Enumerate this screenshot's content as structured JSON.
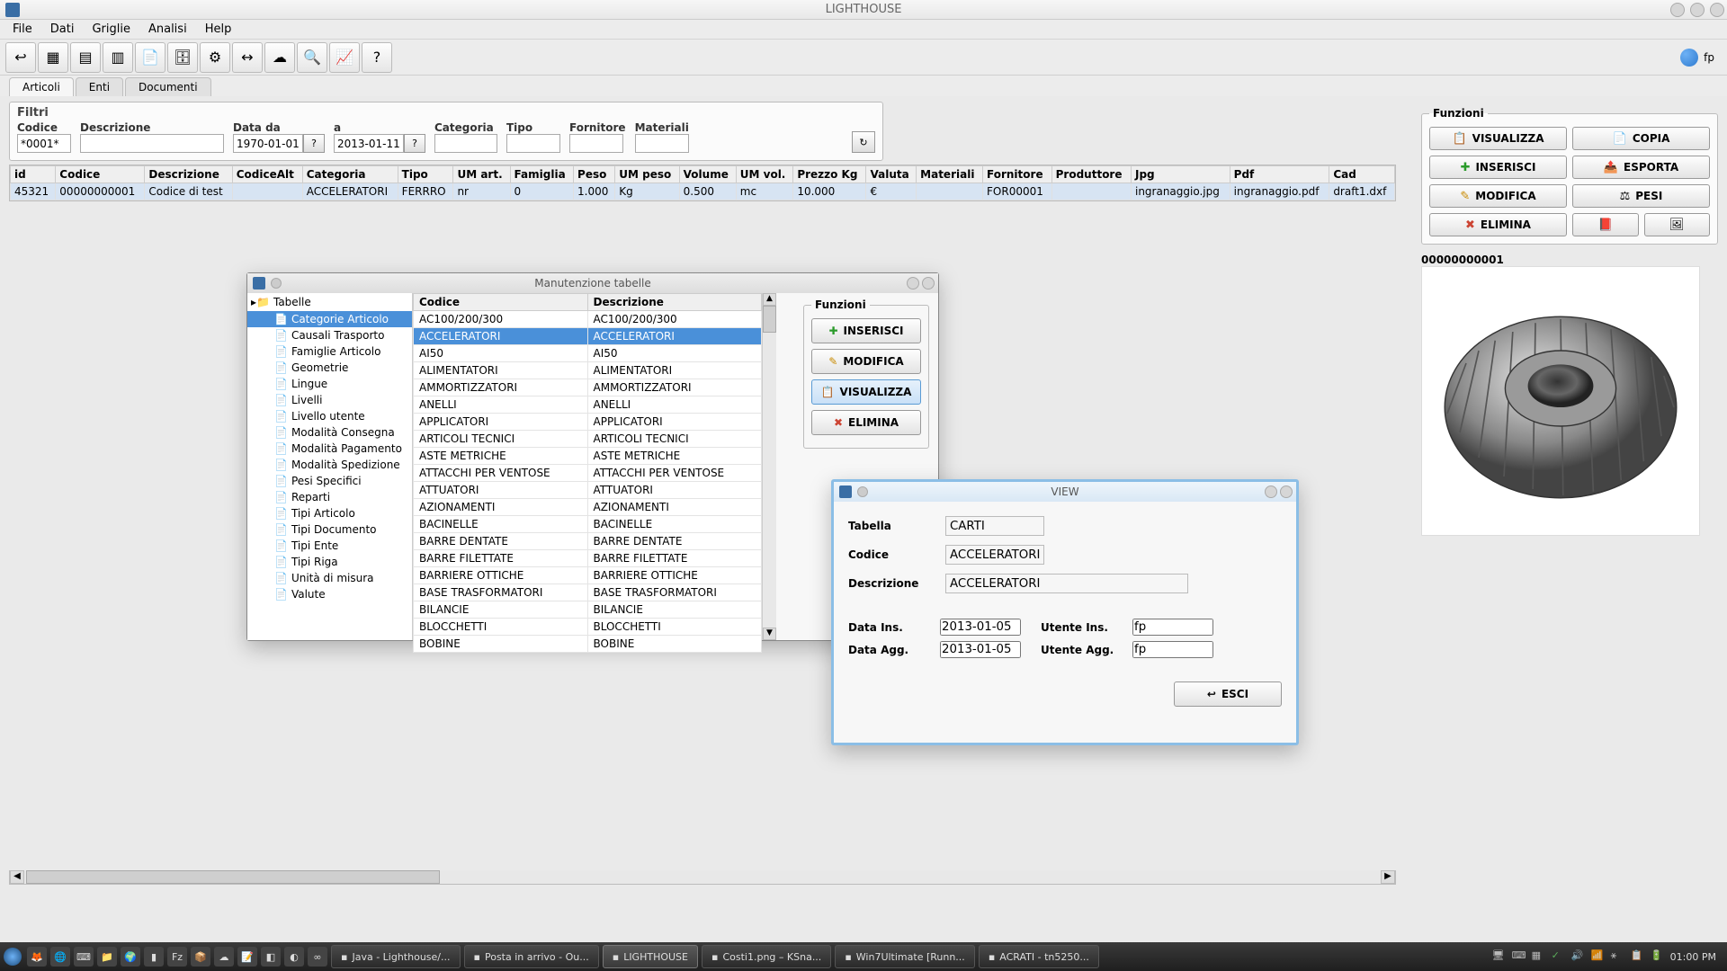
{
  "window_title": "LIGHTHOUSE",
  "menus": [
    "File",
    "Dati",
    "Griglie",
    "Analisi",
    "Help"
  ],
  "user_label": "fp",
  "tabs": [
    {
      "label": "Articoli",
      "active": true
    },
    {
      "label": "Enti",
      "active": false
    },
    {
      "label": "Documenti",
      "active": false
    }
  ],
  "filters": {
    "legend": "Filtri",
    "fields": {
      "codice": {
        "label": "Codice",
        "value": "*0001*"
      },
      "descrizione": {
        "label": "Descrizione",
        "value": ""
      },
      "data_da": {
        "label": "Data da",
        "value": "1970-01-01"
      },
      "data_a": {
        "label": "a",
        "value": "2013-01-11"
      },
      "categoria": {
        "label": "Categoria",
        "value": ""
      },
      "tipo": {
        "label": "Tipo",
        "value": ""
      },
      "fornitore": {
        "label": "Fornitore",
        "value": ""
      },
      "materiali": {
        "label": "Materiali",
        "value": ""
      }
    }
  },
  "table": {
    "columns": [
      "id",
      "Codice",
      "Descrizione",
      "CodiceAlt",
      "Categoria",
      "Tipo",
      "UM art.",
      "Famiglia",
      "Peso",
      "UM peso",
      "Volume",
      "UM vol.",
      "Prezzo Kg",
      "Valuta",
      "Materiali",
      "Fornitore",
      "Produttore",
      "Jpg",
      "Pdf",
      "Cad"
    ],
    "rows": [
      {
        "id": "45321",
        "codice": "00000000001",
        "descr": "Codice di test",
        "codalt": "",
        "cat": "ACCELERATORI",
        "tipo": "FERRRO",
        "um": "nr",
        "fam": "0",
        "peso": "1.000",
        "ump": "Kg",
        "vol": "0.500",
        "umv": "mc",
        "prz": "10.000",
        "val": "€",
        "mat": "",
        "forn": "FOR00001",
        "prod": "",
        "jpg": "ingranaggio.jpg",
        "pdf": "ingranaggio.pdf",
        "cad": "draft1.dxf"
      }
    ]
  },
  "functions": {
    "legend": "Funzioni",
    "buttons": {
      "visualizza": "VISUALIZZA",
      "copia": "COPIA",
      "inserisci": "INSERISCI",
      "esporta": "ESPORTA",
      "modifica": "MODIFICA",
      "pesi": "PESI",
      "elimina": "ELIMINA"
    },
    "code": "00000000001"
  },
  "manut": {
    "title": "Manutenzione tabelle",
    "root": "Tabelle",
    "tree": [
      "Categorie Articolo",
      "Causali Trasporto",
      "Famiglie Articolo",
      "Geometrie",
      "Lingue",
      "Livelli",
      "Livello utente",
      "Modalità Consegna",
      "Modalità Pagamento",
      "Modalità Spedizione",
      "Pesi Specifici",
      "Reparti",
      "Tipi Articolo",
      "Tipi Documento",
      "Tipi Ente",
      "Tipi Riga",
      "Unità di misura",
      "Valute"
    ],
    "tree_selected": 0,
    "list_headers": [
      "Codice",
      "Descrizione"
    ],
    "list": [
      [
        "AC100/200/300",
        "AC100/200/300"
      ],
      [
        "ACCELERATORI",
        "ACCELERATORI"
      ],
      [
        "AI50",
        "AI50"
      ],
      [
        "ALIMENTATORI",
        "ALIMENTATORI"
      ],
      [
        "AMMORTIZZATORI",
        "AMMORTIZZATORI"
      ],
      [
        "ANELLI",
        "ANELLI"
      ],
      [
        "APPLICATORI",
        "APPLICATORI"
      ],
      [
        "ARTICOLI TECNICI",
        "ARTICOLI TECNICI"
      ],
      [
        "ASTE METRICHE",
        "ASTE METRICHE"
      ],
      [
        "ATTACCHI PER VENTOSE",
        "ATTACCHI PER VENTOSE"
      ],
      [
        "ATTUATORI",
        "ATTUATORI"
      ],
      [
        "AZIONAMENTI",
        "AZIONAMENTI"
      ],
      [
        "BACINELLE",
        "BACINELLE"
      ],
      [
        "BARRE DENTATE",
        "BARRE DENTATE"
      ],
      [
        "BARRE FILETTATE",
        "BARRE FILETTATE"
      ],
      [
        "BARRIERE OTTICHE",
        "BARRIERE OTTICHE"
      ],
      [
        "BASE TRASFORMATORI",
        "BASE TRASFORMATORI"
      ],
      [
        "BILANCIE",
        "BILANCIE"
      ],
      [
        "BLOCCHETTI",
        "BLOCCHETTI"
      ],
      [
        "BOBINE",
        "BOBINE"
      ]
    ],
    "list_selected": 1,
    "func_legend": "Funzioni",
    "func_buttons": {
      "inserisci": "INSERISCI",
      "modifica": "MODIFICA",
      "visualizza": "VISUALIZZA",
      "elimina": "ELIMINA"
    }
  },
  "view": {
    "title": "VIEW",
    "fields": {
      "tabella": {
        "label": "Tabella",
        "value": "CARTI"
      },
      "codice": {
        "label": "Codice",
        "value": "ACCELERATORI"
      },
      "descrizione": {
        "label": "Descrizione",
        "value": "ACCELERATORI"
      },
      "data_ins": {
        "label": "Data Ins.",
        "value": "2013-01-05"
      },
      "utente_ins": {
        "label": "Utente Ins.",
        "value": "fp"
      },
      "data_agg": {
        "label": "Data Agg.",
        "value": "2013-01-05"
      },
      "utente_agg": {
        "label": "Utente Agg.",
        "value": "fp"
      }
    },
    "exit": "ESCI"
  },
  "taskbar": {
    "tasks": [
      "Java - Lighthouse/...",
      "Posta in arrivo - Ou...",
      "LIGHTHOUSE",
      "Costi1.png – KSna...",
      "Win7Ultimate [Runn...",
      "ACRATI - tn5250..."
    ],
    "clock": "01:00 PM"
  }
}
